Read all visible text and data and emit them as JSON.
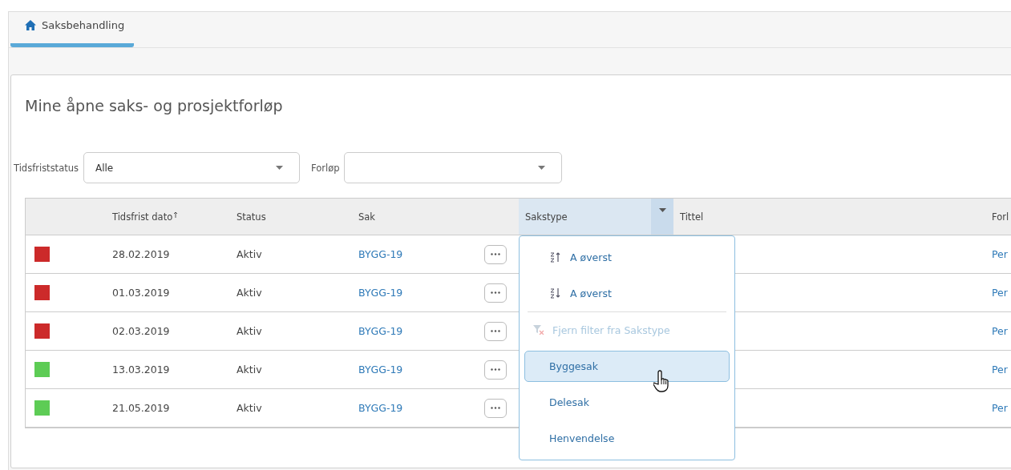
{
  "tab": {
    "label": "Saksbehandling",
    "selected": true
  },
  "panel": {
    "title": "Mine åpne saks- og prosjektforløp"
  },
  "filters": [
    {
      "label": "Tidsfriststatus",
      "value": "Alle"
    },
    {
      "label": "Forløp"
    }
  ],
  "table": {
    "columns": [
      {
        "label": "Tidsfrist dato",
        "sorted": true,
        "menu_open": false
      },
      {
        "label": "Status",
        "sorted": false,
        "menu_open": false
      },
      {
        "label": "Sak",
        "sorted": false,
        "menu_open": false
      },
      {
        "label": "Sakstype",
        "sorted": false,
        "menu_open": true
      },
      {
        "label": "Tittel",
        "sorted": false,
        "menu_open": false
      },
      {
        "label": "Forl",
        "menu_open": false
      }
    ],
    "rows": [
      {
        "color": "#cc2a2a",
        "date": "28.02.2019",
        "status": "Aktiv",
        "case": "BYGG-19",
        "column_6": "Per"
      },
      {
        "color": "#cc2a2a",
        "date": "01.03.2019",
        "status": "Aktiv",
        "case": "BYGG-19",
        "column_6": "Per"
      },
      {
        "color": "#cc2a2a",
        "date": "02.03.2019",
        "status": "Aktiv",
        "case": "BYGG-19",
        "column_6": "Per"
      },
      {
        "color": "#5dcc55",
        "date": "13.03.2019",
        "status": "Aktiv",
        "case": "BYGG-19",
        "column_6": "Per"
      },
      {
        "color": "#5dcc55",
        "date": "21.05.2019",
        "status": "Aktiv",
        "case": "BYGG-19",
        "column_6": "Per"
      }
    ]
  },
  "menu": {
    "items": [
      {
        "kind": "sort_asc",
        "label": "A øverst"
      },
      {
        "kind": "sort_desc",
        "label": "A øverst"
      },
      {
        "kind": "action",
        "label": "Fjern filter fra Sakstype",
        "disabled": true
      },
      {
        "kind": "option",
        "label": "Byggesak",
        "selected": true
      },
      {
        "kind": "option",
        "label": "Delesak",
        "selected": false
      },
      {
        "kind": "option",
        "label": "Henvendelse",
        "selected": false
      }
    ]
  }
}
